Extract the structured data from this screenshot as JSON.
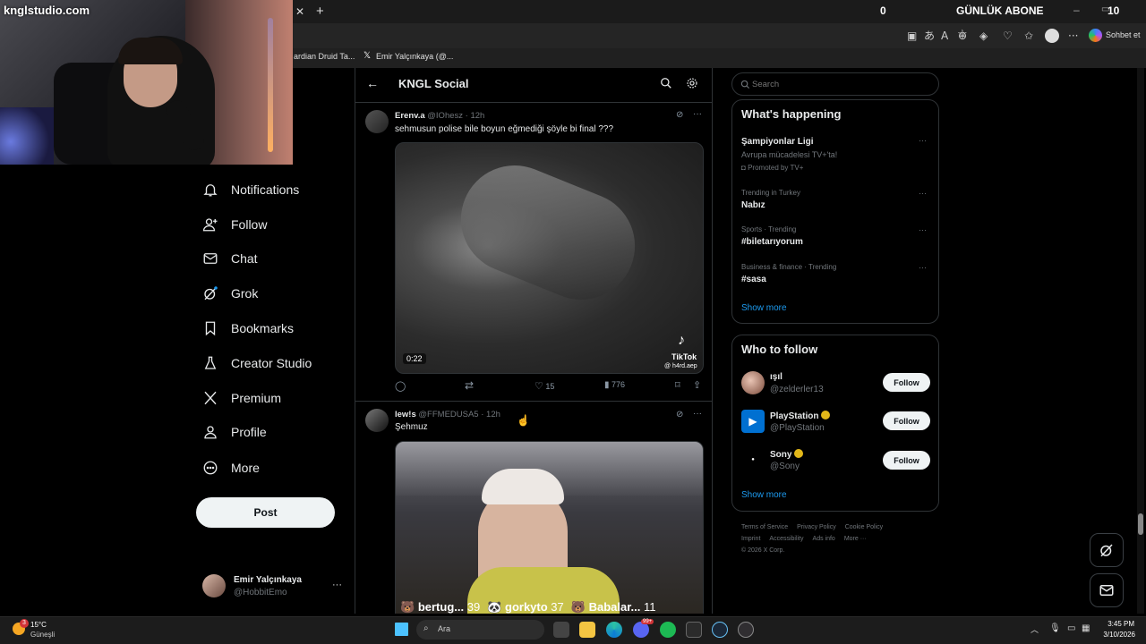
{
  "browser": {
    "tabs": [
      {
        "label": "ardian Druid Ta..."
      },
      {
        "label": "Emir Yalçınkaya (@..."
      }
    ],
    "sohbet_label": "Sohbet et"
  },
  "overlay": {
    "brand": "knglstudio.com",
    "counter_left": "0",
    "gunluk_label": "GÜNLÜK ABONE",
    "counter_right": "10"
  },
  "nav": {
    "items": [
      {
        "label": "Notifications",
        "icon": "bell-icon"
      },
      {
        "label": "Follow",
        "icon": "person-plus-icon"
      },
      {
        "label": "Chat",
        "icon": "envelope-icon"
      },
      {
        "label": "Grok",
        "icon": "grok-icon"
      },
      {
        "label": "Bookmarks",
        "icon": "bookmark-icon"
      },
      {
        "label": "Creator Studio",
        "icon": "flask-icon"
      },
      {
        "label": "Premium",
        "icon": "x-logo-icon"
      },
      {
        "label": "Profile",
        "icon": "person-icon"
      },
      {
        "label": "More",
        "icon": "more-circle-icon"
      }
    ],
    "post_label": "Post",
    "account": {
      "name": "Emir Yalçınkaya",
      "handle": "@HobbitEmo"
    }
  },
  "header": {
    "title": "KNGL Social"
  },
  "tweets": [
    {
      "name": "Erenv.a",
      "handle": "@IOhesz",
      "time": "· 12h",
      "text": "sehmusun polise bile boyun eğmediği şöyle bi final ???",
      "video_duration": "0:22",
      "tiktok_label": "TikTok",
      "tiktok_handle": "@ h4rd.aep",
      "likes": "15",
      "views": "776"
    },
    {
      "name": "lew!s",
      "handle": "@FFMEDUSA5",
      "time": "· 12h",
      "text": "Şehmuz",
      "overlay_items": [
        {
          "label": "bertug...",
          "count": "39"
        },
        {
          "label": "gorkyto",
          "count": "37"
        },
        {
          "label": "Babalar...",
          "count": "11"
        }
      ]
    }
  ],
  "search": {
    "placeholder": "Search"
  },
  "happening": {
    "title": "What's happening",
    "trends": [
      {
        "main": "Şampiyonlar Ligi",
        "sub": "Avrupa mücadelesi TV+'ta!",
        "promo": "Promoted by TV+"
      },
      {
        "meta": "Trending in Turkey",
        "main": "Nabız"
      },
      {
        "meta": "Sports · Trending",
        "main": "#biletarıyorum"
      },
      {
        "meta": "Business & finance · Trending",
        "main": "#sasa"
      }
    ],
    "show_more": "Show more"
  },
  "who_to_follow": {
    "title": "Who to follow",
    "accounts": [
      {
        "name": "ışıl",
        "handle": "@zelderler13",
        "button": "Follow"
      },
      {
        "name": "PlayStation",
        "handle": "@PlayStation",
        "button": "Follow"
      },
      {
        "name": "Sony",
        "handle": "@Sony",
        "button": "Follow"
      }
    ],
    "show_more": "Show more"
  },
  "footer": {
    "links": [
      "Terms of Service",
      "Privacy Policy",
      "Cookie Policy",
      "Imprint",
      "Accessibility",
      "Ads info",
      "More ···"
    ],
    "copyright": "© 2026 X Corp."
  },
  "taskbar": {
    "weather_temp": "15°C",
    "weather_label": "Güneşli",
    "weather_badge": "3",
    "search_placeholder": "Ara",
    "time": "3:45 PM",
    "date": "3/10/2026",
    "notif_badge": "99+"
  },
  "colors": {
    "accent": "#1d9bf0",
    "verified": "#e2b719",
    "background": "#000000"
  }
}
